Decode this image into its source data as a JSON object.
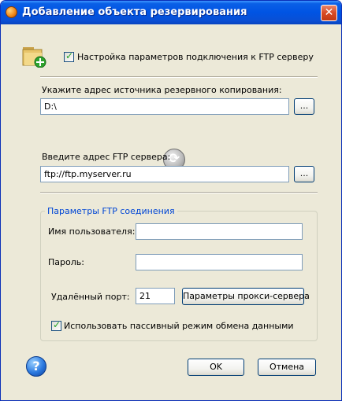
{
  "window": {
    "title": "Добавление объекта резервирования",
    "close_glyph": "✕"
  },
  "icons": {
    "app": "app-icon",
    "folder": "folder-add-icon",
    "sync": "sync-icon",
    "help": "help-icon",
    "close": "close-icon"
  },
  "ftp_settings_checkbox": {
    "label": "Настройка параметров подключения к FTP серверу",
    "checked": true
  },
  "source": {
    "label": "Укажите адрес источника резервного копирования:",
    "value": "D:\\",
    "browse_label": "..."
  },
  "ftp_server": {
    "label": "Введите адрес FTP сервера:",
    "value": "ftp://ftp.myserver.ru",
    "browse_label": "..."
  },
  "connection": {
    "title": "Параметры FTP соединения",
    "username_label": "Имя пользователя:",
    "username_value": "",
    "password_label": "Пароль:",
    "password_value": "",
    "port_label": "Удалённый порт:",
    "port_value": "21",
    "proxy_button": "Параметры прокси-сервера",
    "passive_label": "Использовать пассивный режим обмена данными",
    "passive_checked": true
  },
  "buttons": {
    "ok": "OK",
    "cancel": "Отмена",
    "help_glyph": "?"
  },
  "colors": {
    "titlebar": "#0054e3",
    "dialog_bg": "#ece9d8",
    "group_title": "#0046d5",
    "check_mark": "#21a121"
  }
}
